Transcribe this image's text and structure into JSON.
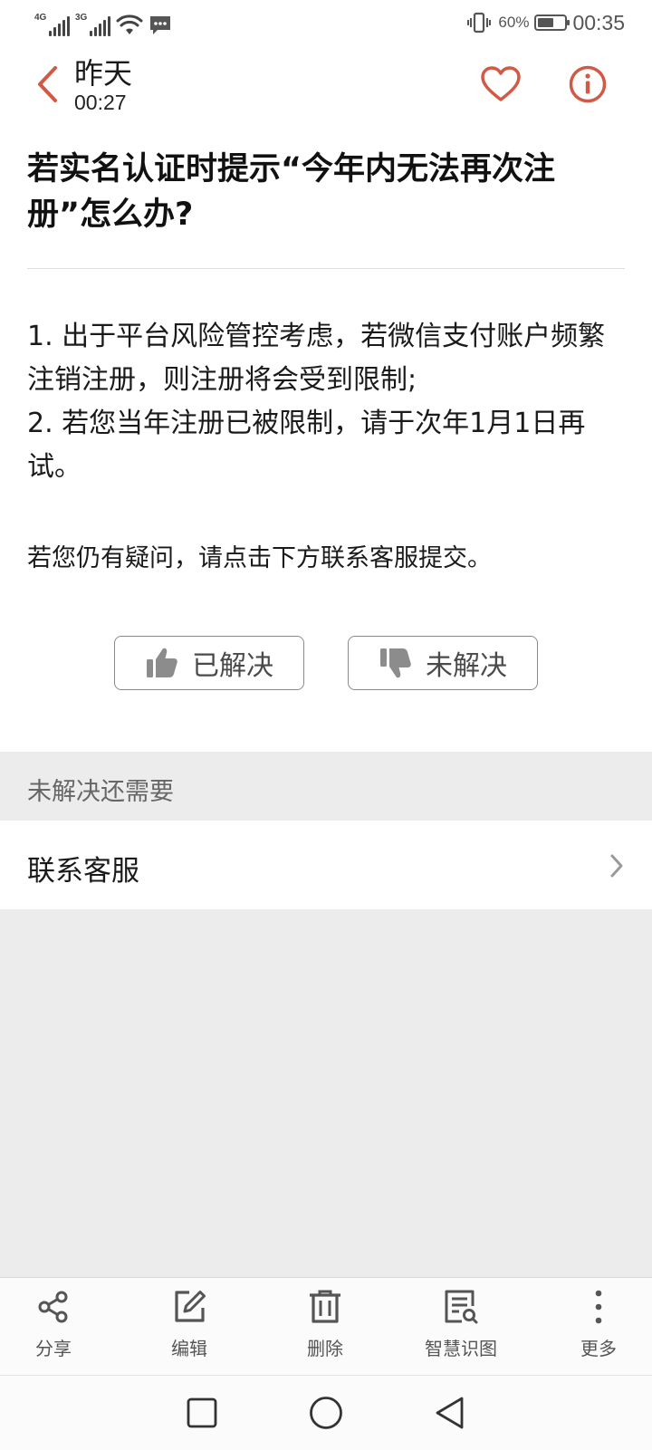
{
  "status_bar": {
    "network1": "4G",
    "network2": "3G",
    "battery_percent": "60%",
    "battery_level": 0.6,
    "time": "00:35",
    "icons": [
      "signal-icon",
      "wifi-icon",
      "message-icon",
      "vibrate-icon",
      "battery-icon"
    ]
  },
  "header": {
    "title": "昨天",
    "subtitle": "00:27",
    "accent_color": "#d05a45"
  },
  "article": {
    "title": "若实名认证时提示“今年内无法再次注册”怎么办?",
    "paragraphs": [
      "1. 出于平台风险管控考虑，若微信支付账户频繁注销注册，则注册将会受到限制;",
      "2. 若您当年注册已被限制，请于次年1月1日再试。"
    ],
    "note": "若您仍有疑问，请点击下方联系客服提交。"
  },
  "feedback": {
    "solved_label": "已解决",
    "unsolved_label": "未解决"
  },
  "section": {
    "label": "未解决还需要",
    "contact_label": "联系客服"
  },
  "toolbar": {
    "share": "分享",
    "edit": "编辑",
    "delete": "删除",
    "smart_recognize": "智慧识图",
    "more": "更多"
  }
}
